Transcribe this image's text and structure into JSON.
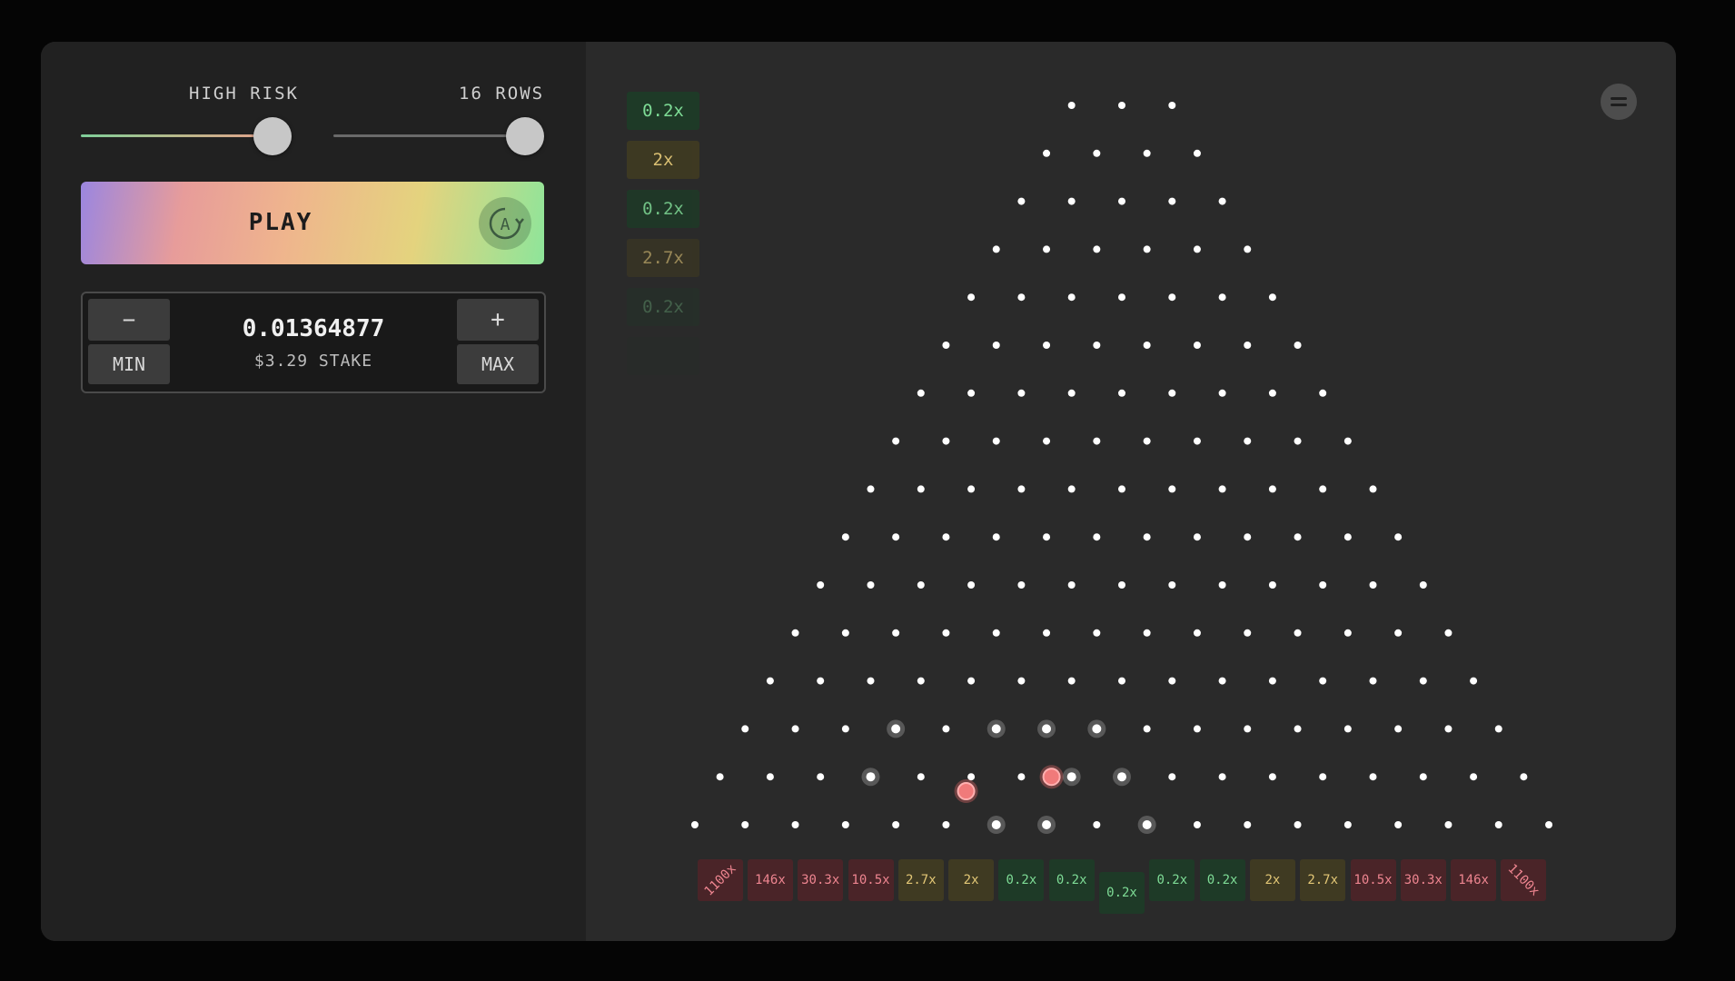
{
  "controls": {
    "risk_label": "HIGH RISK",
    "rows_label": "16 ROWS",
    "risk_level": 1.0,
    "rows_level": 1.0,
    "play_label": "PLAY",
    "auto_icon": "autoplay-icon",
    "minus_label": "−",
    "plus_label": "+",
    "min_label": "MIN",
    "max_label": "MAX",
    "stake_amount": "0.01364877",
    "stake_usd": "$3.29 STAKE"
  },
  "history": [
    {
      "label": "0.2x",
      "tone": "green",
      "opacity": 1.0
    },
    {
      "label": "2x",
      "tone": "yellow",
      "opacity": 0.95
    },
    {
      "label": "0.2x",
      "tone": "green",
      "opacity": 0.85
    },
    {
      "label": "2.7x",
      "tone": "yellow",
      "opacity": 0.6
    },
    {
      "label": "0.2x",
      "tone": "green",
      "opacity": 0.3
    },
    {
      "label": "",
      "tone": "green",
      "opacity": 0.12
    }
  ],
  "menu_icon": "menu-icon",
  "board": {
    "rows": 16,
    "highlighted_pegs": [
      [
        13,
        3
      ],
      [
        13,
        5
      ],
      [
        13,
        6
      ],
      [
        13,
        7
      ],
      [
        14,
        3
      ],
      [
        14,
        7
      ],
      [
        14,
        8
      ],
      [
        15,
        6
      ],
      [
        15,
        7
      ],
      [
        15,
        9
      ]
    ],
    "balls": [
      {
        "row": 14.3,
        "pos": 4.9
      },
      {
        "row": 14.0,
        "pos": 6.6
      }
    ]
  },
  "buckets": [
    {
      "label": "1100x",
      "tone": "red"
    },
    {
      "label": "146x",
      "tone": "red"
    },
    {
      "label": "30.3x",
      "tone": "red"
    },
    {
      "label": "10.5x",
      "tone": "red"
    },
    {
      "label": "2.7x",
      "tone": "yellow"
    },
    {
      "label": "2x",
      "tone": "yellow"
    },
    {
      "label": "0.2x",
      "tone": "green"
    },
    {
      "label": "0.2x",
      "tone": "green"
    },
    {
      "label": "0.2x",
      "tone": "green"
    },
    {
      "label": "0.2x",
      "tone": "green"
    },
    {
      "label": "0.2x",
      "tone": "green"
    },
    {
      "label": "2x",
      "tone": "yellow"
    },
    {
      "label": "2.7x",
      "tone": "yellow"
    },
    {
      "label": "10.5x",
      "tone": "red"
    },
    {
      "label": "30.3x",
      "tone": "red"
    },
    {
      "label": "146x",
      "tone": "red"
    },
    {
      "label": "1100x",
      "tone": "red"
    }
  ],
  "colors": {
    "green_bg": "#1e3a27",
    "green_fg": "#7edc96",
    "yellow_bg": "#3f3a22",
    "yellow_fg": "#e3c776",
    "red_bg": "#4a2428",
    "red_fg": "#ee8590",
    "ball": "#f07a7a"
  }
}
